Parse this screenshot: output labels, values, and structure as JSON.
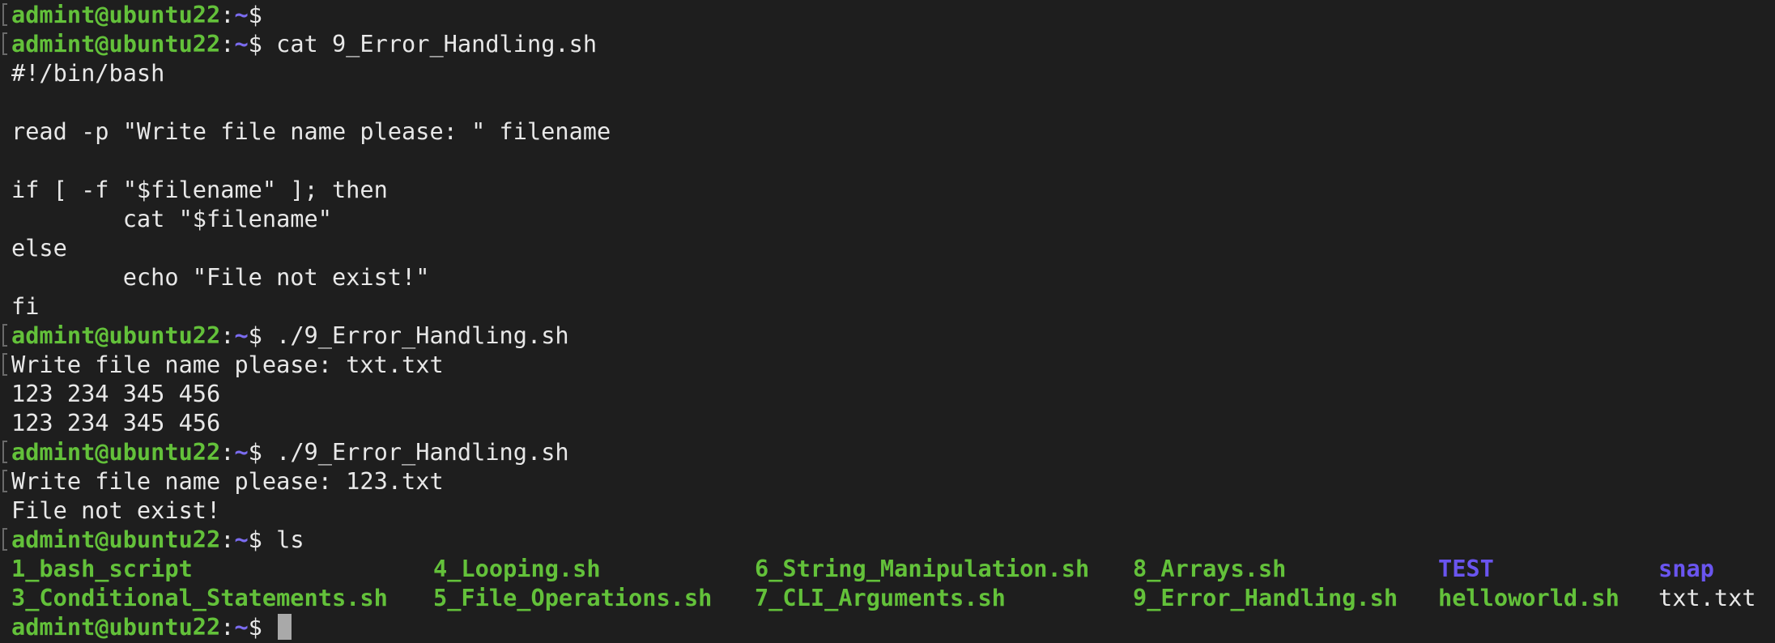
{
  "prompt": {
    "user_host": "admint@ubuntu22",
    "colon": ":",
    "path": "~",
    "symbol": "$"
  },
  "lines": [
    {
      "type": "prompt",
      "cmd": ""
    },
    {
      "type": "prompt",
      "cmd": " cat 9_Error_Handling.sh"
    },
    {
      "type": "out",
      "text": "#!/bin/bash"
    },
    {
      "type": "out",
      "text": ""
    },
    {
      "type": "out",
      "text": "read -p \"Write file name please: \" filename"
    },
    {
      "type": "out",
      "text": ""
    },
    {
      "type": "out",
      "text": "if [ -f \"$filename\" ]; then"
    },
    {
      "type": "out",
      "text": "        cat \"$filename\""
    },
    {
      "type": "out",
      "text": "else"
    },
    {
      "type": "out",
      "text": "        echo \"File not exist!\""
    },
    {
      "type": "out",
      "text": "fi"
    },
    {
      "type": "prompt",
      "cmd": " ./9_Error_Handling.sh"
    },
    {
      "type": "out",
      "text": "Write file name please: txt.txt"
    },
    {
      "type": "out",
      "text": "123 234 345 456"
    },
    {
      "type": "out",
      "text": "123 234 345 456"
    },
    {
      "type": "prompt",
      "cmd": " ./9_Error_Handling.sh"
    },
    {
      "type": "out",
      "text": "Write file name please: 123.txt"
    },
    {
      "type": "out",
      "text": "File not exist!"
    },
    {
      "type": "prompt",
      "cmd": " ls"
    }
  ],
  "ls_output": {
    "row1": [
      "1_bash_script",
      "4_Looping.sh",
      "6_String_Manipulation.sh",
      "8_Arrays.sh",
      "TEST",
      "snap"
    ],
    "row2": [
      "3_Conditional_Statements.sh",
      "5_File_Operations.sh",
      "7_CLI_Arguments.sh",
      "9_Error_Handling.sh",
      "helloworld.sh",
      "txt.txt"
    ]
  },
  "colors": {
    "background": "#1e1e1e",
    "prompt_user": "#63c13a",
    "prompt_path": "#7b6cf0",
    "executable": "#63c13a",
    "directory": "#6a55f0",
    "text": "#e8e8e8"
  }
}
